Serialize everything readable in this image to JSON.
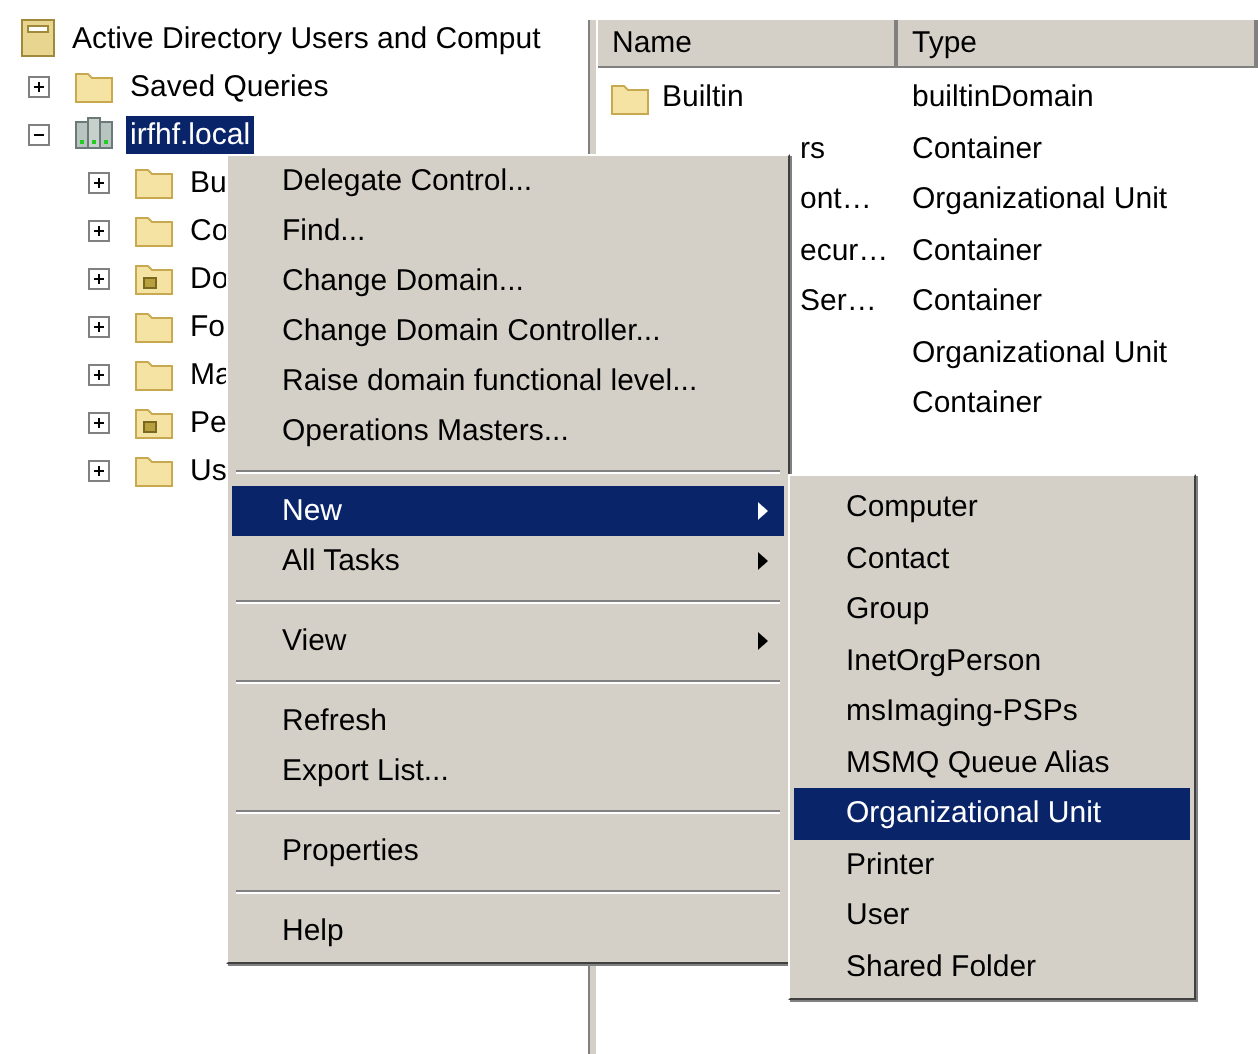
{
  "tree": {
    "root": {
      "label": "Active Directory Users and Comput"
    },
    "items": [
      {
        "label": "Saved Queries",
        "kind": "folder",
        "expanded": false,
        "selected": false
      },
      {
        "label": "irfhf.local",
        "kind": "domain",
        "expanded": true,
        "selected": true,
        "children": [
          {
            "label": "Bu",
            "kind": "folder",
            "expanded": false,
            "selected": false
          },
          {
            "label": "Co",
            "kind": "folder",
            "expanded": false,
            "selected": false
          },
          {
            "label": "Do",
            "kind": "ou",
            "expanded": false,
            "selected": false
          },
          {
            "label": "Fo",
            "kind": "folder",
            "expanded": false,
            "selected": false
          },
          {
            "label": "Ma",
            "kind": "folder",
            "expanded": false,
            "selected": false
          },
          {
            "label": "Pe",
            "kind": "ou",
            "expanded": false,
            "selected": false
          },
          {
            "label": "Us",
            "kind": "folder",
            "expanded": false,
            "selected": false
          }
        ]
      }
    ]
  },
  "list": {
    "columns": [
      "Name",
      "Type"
    ],
    "rows": [
      {
        "name": "Builtin",
        "type": "builtinDomain",
        "covered": false
      },
      {
        "name": "rs",
        "type": "Container",
        "covered": true
      },
      {
        "name": "ont…",
        "type": "Organizational Unit",
        "covered": true
      },
      {
        "name": "ecur…",
        "type": "Container",
        "covered": true
      },
      {
        "name": "Ser…",
        "type": "Container",
        "covered": true
      },
      {
        "type": "Organizational Unit"
      },
      {
        "type": "Container"
      }
    ]
  },
  "context_menu": {
    "items": [
      {
        "kind": "item",
        "label": "Delegate Control...",
        "submenu": false,
        "selected": false
      },
      {
        "kind": "item",
        "label": "Find...",
        "submenu": false,
        "selected": false
      },
      {
        "kind": "item",
        "label": "Change Domain...",
        "submenu": false,
        "selected": false
      },
      {
        "kind": "item",
        "label": "Change Domain Controller...",
        "submenu": false,
        "selected": false
      },
      {
        "kind": "item",
        "label": "Raise domain functional level...",
        "submenu": false,
        "selected": false
      },
      {
        "kind": "item",
        "label": "Operations Masters...",
        "submenu": false,
        "selected": false
      },
      {
        "kind": "separator"
      },
      {
        "kind": "item",
        "label": "New",
        "submenu": true,
        "selected": true
      },
      {
        "kind": "item",
        "label": "All Tasks",
        "submenu": true,
        "selected": false
      },
      {
        "kind": "separator"
      },
      {
        "kind": "item",
        "label": "View",
        "submenu": true,
        "selected": false
      },
      {
        "kind": "separator"
      },
      {
        "kind": "item",
        "label": "Refresh",
        "submenu": false,
        "selected": false
      },
      {
        "kind": "item",
        "label": "Export List...",
        "submenu": false,
        "selected": false
      },
      {
        "kind": "separator"
      },
      {
        "kind": "item",
        "label": "Properties",
        "submenu": false,
        "selected": false
      },
      {
        "kind": "separator"
      },
      {
        "kind": "item",
        "label": "Help",
        "submenu": false,
        "selected": false
      }
    ]
  },
  "submenu": {
    "items": [
      {
        "label": "Computer",
        "selected": false
      },
      {
        "label": "Contact",
        "selected": false
      },
      {
        "label": "Group",
        "selected": false
      },
      {
        "label": "InetOrgPerson",
        "selected": false
      },
      {
        "label": "msImaging-PSPs",
        "selected": false
      },
      {
        "label": "MSMQ Queue Alias",
        "selected": false
      },
      {
        "label": "Organizational Unit",
        "selected": true
      },
      {
        "label": "Printer",
        "selected": false
      },
      {
        "label": "User",
        "selected": false
      },
      {
        "label": "Shared Folder",
        "selected": false
      }
    ]
  }
}
